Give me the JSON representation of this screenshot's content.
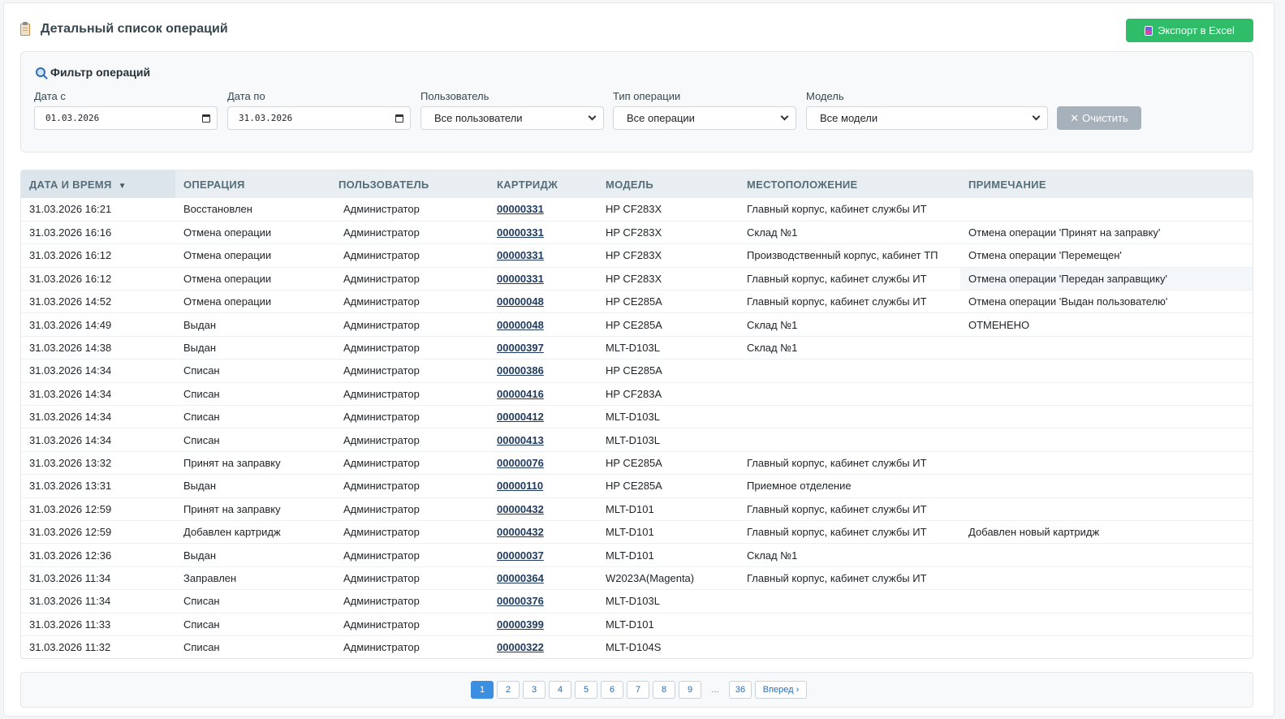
{
  "header": {
    "title": "Детальный список операций",
    "export_label": "Экспорт в Excel"
  },
  "filter": {
    "title": "Фильтр операций",
    "date_from_label": "Дата с",
    "date_from_value": "01.03.2026",
    "date_to_label": "Дата по",
    "date_to_value": "31.03.2026",
    "user_label": "Пользователь",
    "user_value": "Все пользователи",
    "optype_label": "Тип операции",
    "optype_value": "Все операции",
    "model_label": "Модель",
    "model_value": "Все модели",
    "clear_label": "Очистить"
  },
  "table": {
    "columns": [
      "ДАТА И ВРЕМЯ",
      "ОПЕРАЦИЯ",
      "ПОЛЬЗОВАТЕЛЬ",
      "КАРТРИДЖ",
      "МОДЕЛЬ",
      "МЕСТОПОЛОЖЕНИЕ",
      "ПРИМЕЧАНИЕ"
    ],
    "sort_indicator": "▼",
    "rows": [
      [
        "31.03.2026 16:21",
        "Восстановлен",
        "Администратор",
        "00000331",
        "HP CF283X",
        "Главный корпус, кабинет службы ИТ",
        ""
      ],
      [
        "31.03.2026 16:16",
        "Отмена операции",
        "Администратор",
        "00000331",
        "HP CF283X",
        "Склад №1",
        "Отмена операции 'Принят на заправку'"
      ],
      [
        "31.03.2026 16:12",
        "Отмена операции",
        "Администратор",
        "00000331",
        "HP CF283X",
        "Производственный корпус, кабинет ТП",
        "Отмена операции 'Перемещен'"
      ],
      [
        "31.03.2026 16:12",
        "Отмена операции",
        "Администратор",
        "00000331",
        "HP CF283X",
        "Главный корпус, кабинет службы ИТ",
        "Отмена операции 'Передан заправщику'"
      ],
      [
        "31.03.2026 14:52",
        "Отмена операции",
        "Администратор",
        "00000048",
        "HP CE285A",
        "Главный корпус, кабинет службы ИТ",
        "Отмена операции 'Выдан пользователю'"
      ],
      [
        "31.03.2026 14:49",
        "Выдан",
        "Администратор",
        "00000048",
        "HP CE285A",
        "Склад №1",
        "ОТМЕНЕНО"
      ],
      [
        "31.03.2026 14:38",
        "Выдан",
        "Администратор",
        "00000397",
        "MLT-D103L",
        "Склад №1",
        ""
      ],
      [
        "31.03.2026 14:34",
        "Списан",
        "Администратор",
        "00000386",
        "HP CE285A",
        "",
        ""
      ],
      [
        "31.03.2026 14:34",
        "Списан",
        "Администратор",
        "00000416",
        "HP CF283A",
        "",
        ""
      ],
      [
        "31.03.2026 14:34",
        "Списан",
        "Администратор",
        "00000412",
        "MLT-D103L",
        "",
        ""
      ],
      [
        "31.03.2026 14:34",
        "Списан",
        "Администратор",
        "00000413",
        "MLT-D103L",
        "",
        ""
      ],
      [
        "31.03.2026 13:32",
        "Принят на заправку",
        "Администратор",
        "00000076",
        "HP CE285A",
        "Главный корпус, кабинет службы ИТ",
        ""
      ],
      [
        "31.03.2026 13:31",
        "Выдан",
        "Администратор",
        "00000110",
        "HP CE285A",
        "Приемное отделение",
        ""
      ],
      [
        "31.03.2026 12:59",
        "Принят на заправку",
        "Администратор",
        "00000432",
        "MLT-D101",
        "Главный корпус, кабинет службы ИТ",
        ""
      ],
      [
        "31.03.2026 12:59",
        "Добавлен картридж",
        "Администратор",
        "00000432",
        "MLT-D101",
        "Главный корпус, кабинет службы ИТ",
        "Добавлен новый картридж"
      ],
      [
        "31.03.2026 12:36",
        "Выдан",
        "Администратор",
        "00000037",
        "MLT-D101",
        "Склад №1",
        ""
      ],
      [
        "31.03.2026 11:34",
        "Заправлен",
        "Администратор",
        "00000364",
        "W2023A(Magenta)",
        "Главный корпус, кабинет службы ИТ",
        ""
      ],
      [
        "31.03.2026 11:34",
        "Списан",
        "Администратор",
        "00000376",
        "MLT-D103L",
        "",
        ""
      ],
      [
        "31.03.2026 11:33",
        "Списан",
        "Администратор",
        "00000399",
        "MLT-D101",
        "",
        ""
      ],
      [
        "31.03.2026 11:32",
        "Списан",
        "Администратор",
        "00000322",
        "MLT-D104S",
        "",
        ""
      ]
    ]
  },
  "pagination": {
    "pages": [
      "1",
      "2",
      "3",
      "4",
      "5",
      "6",
      "7",
      "8",
      "9"
    ],
    "ellipsis": "...",
    "last_page": "36",
    "next_label": "Вперед",
    "next_arrow": "›",
    "current": "1"
  },
  "icons": {
    "title_icon": "clipboard-icon",
    "filter_icon": "magnifier-icon",
    "export_icon": "excel-icon",
    "clear_icon": "✕"
  },
  "colors": {
    "export_button": "#2fbd6a",
    "clear_button": "#a7b1bc",
    "active_page": "#3b8fe0"
  }
}
